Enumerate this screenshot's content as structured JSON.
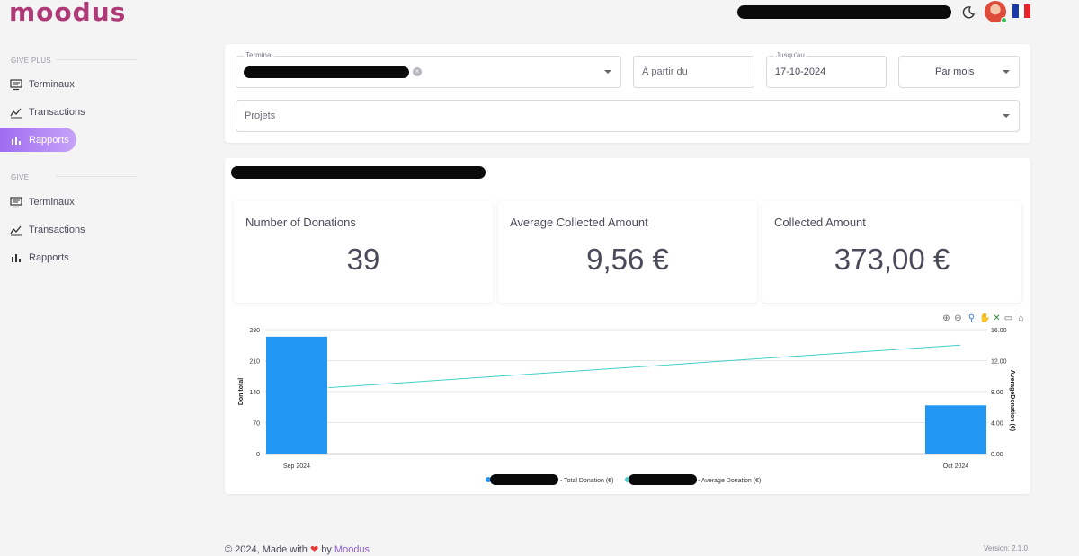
{
  "app": {
    "logo": "moodus"
  },
  "header": {
    "icons": {
      "theme": "moon-icon",
      "avatar": "avatar",
      "language": "fr-flag-icon"
    },
    "colors": {
      "online": "#33c15a"
    }
  },
  "sidebar": {
    "sections": [
      {
        "title": "GIVE PLUS",
        "items": [
          {
            "label": "Terminaux",
            "icon": "monitor-icon"
          },
          {
            "label": "Transactions",
            "icon": "trend-icon"
          },
          {
            "label": "Rapports",
            "icon": "bar-chart-icon",
            "active": true
          }
        ]
      },
      {
        "title": "GIVE",
        "items": [
          {
            "label": "Terminaux",
            "icon": "monitor-icon"
          },
          {
            "label": "Transactions",
            "icon": "trend-icon"
          },
          {
            "label": "Rapports",
            "icon": "bar-chart-icon"
          }
        ]
      }
    ]
  },
  "filters": {
    "terminal_label": "Terminal",
    "from_placeholder": "À partir du",
    "to_label": "Jusqu'au",
    "to_value": "17-10-2024",
    "period_value": "Par mois",
    "projects_placeholder": "Projets"
  },
  "stats": [
    {
      "title": "Number of Donations",
      "value": "39"
    },
    {
      "title": "Average Collected Amount",
      "value": "9,56 €"
    },
    {
      "title": "Collected Amount",
      "value": "373,00 €"
    }
  ],
  "chart_data": {
    "type": "bar",
    "categories": [
      "Sep 2024",
      "Oct 2024"
    ],
    "series": [
      {
        "name": "Total Donation (€)",
        "kind": "bar",
        "axis": "left",
        "values": [
          264,
          109
        ],
        "color": "#2196f3"
      },
      {
        "name": "Average Donation (€)",
        "kind": "line",
        "axis": "right",
        "values": [
          8.5,
          14.0
        ],
        "color": "#40d0c8"
      }
    ],
    "ylabel": "Don total",
    "y2label": "AverageDonation (€)",
    "ylim": [
      0,
      280
    ],
    "y2lim": [
      0,
      16
    ],
    "yticks": [
      "0",
      "70",
      "140",
      "210",
      "280"
    ],
    "y2ticks": [
      "0.00",
      "4.00",
      "8.00",
      "12.00",
      "16.00"
    ],
    "grid": true,
    "legend": "bottom",
    "toolbar_icons": [
      "zoom-in-icon",
      "zoom-out-icon",
      "magnify-icon",
      "pan-icon",
      "reset-x-icon",
      "reset-icon",
      "home-icon"
    ]
  },
  "footer": {
    "prefix": "© 2024, Made with",
    "by": "by",
    "brand": "Moodus",
    "version": "Version: 2.1.0"
  }
}
